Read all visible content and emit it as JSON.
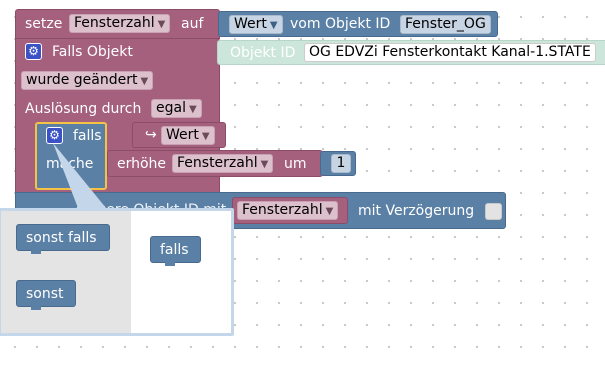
{
  "set_block": {
    "label_setze": "setze",
    "variable": "Fensterzahl",
    "label_auf": "auf",
    "field": "Wert",
    "label_vom": "vom Objekt ID",
    "object": "Fenster_OG"
  },
  "trigger_block": {
    "label": "Falls Objekt",
    "object_id_label": "Objekt ID",
    "object_id_value": "OG EDVZi Fensterkontakt Kanal-1.STATE",
    "condition": "wurde geändert",
    "trigger_label": "Auslösung durch",
    "trigger_value": "egal"
  },
  "if_block": {
    "falls_label": "falls",
    "arrow": "↪",
    "value_field": "Wert",
    "mache_label": "mache",
    "increment_label": "erhöhe",
    "increment_var": "Fensterzahl",
    "um_label": "um",
    "increment_value": "1"
  },
  "control_block": {
    "obscured_label": "steuere Objekt ID mit",
    "variable": "Fensterzahl",
    "delay_label": "mit Verzögerung"
  },
  "mutator_flyout": {
    "items": [
      {
        "label": "sonst falls"
      },
      {
        "label": "sonst"
      }
    ],
    "workspace_block": "falls"
  },
  "colors": {
    "pink": "#a5607e",
    "blue": "#5b80a5",
    "mint": "#cde6dc",
    "highlight": "#f5c343",
    "gear": "#3b52c6"
  }
}
